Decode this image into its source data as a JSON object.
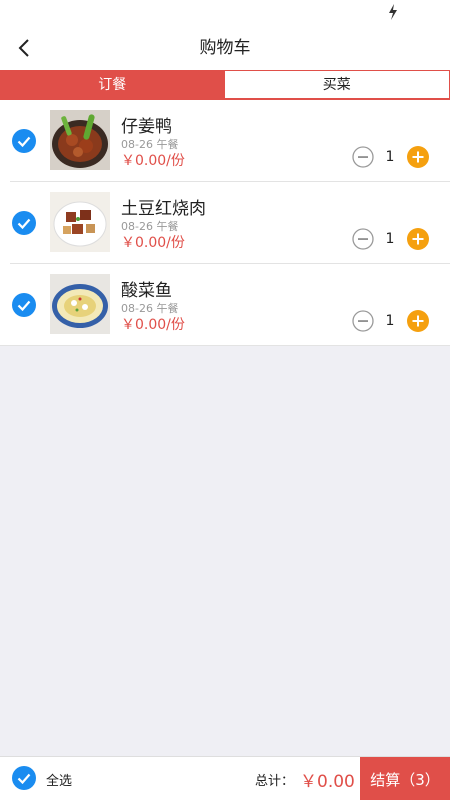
{
  "status_bar": {
    "icon": "bolt-icon"
  },
  "header": {
    "title": "购物车",
    "back_icon": "chevron-left-icon"
  },
  "tabs": [
    {
      "label": "订餐",
      "active": true
    },
    {
      "label": "买菜",
      "active": false
    }
  ],
  "cart_items": [
    {
      "name": "仔姜鸭",
      "meta": "08-26 午餐",
      "price": "￥0.00/份",
      "quantity": "1",
      "checked": true
    },
    {
      "name": "土豆红烧肉",
      "meta": "08-26 午餐",
      "price": "￥0.00/份",
      "quantity": "1",
      "checked": true
    },
    {
      "name": "酸菜鱼",
      "meta": "08-26 午餐",
      "price": "￥0.00/份",
      "quantity": "1",
      "checked": true
    }
  ],
  "footer": {
    "select_all_label": "全选",
    "select_all_checked": true,
    "total_label": "总计：",
    "total_value": "￥0.00",
    "checkout_label": "结算",
    "checkout_count": "（3）"
  },
  "colors": {
    "accent": "#e04f49",
    "check_blue": "#1a8cf0",
    "plus_orange": "#f5a00f"
  }
}
